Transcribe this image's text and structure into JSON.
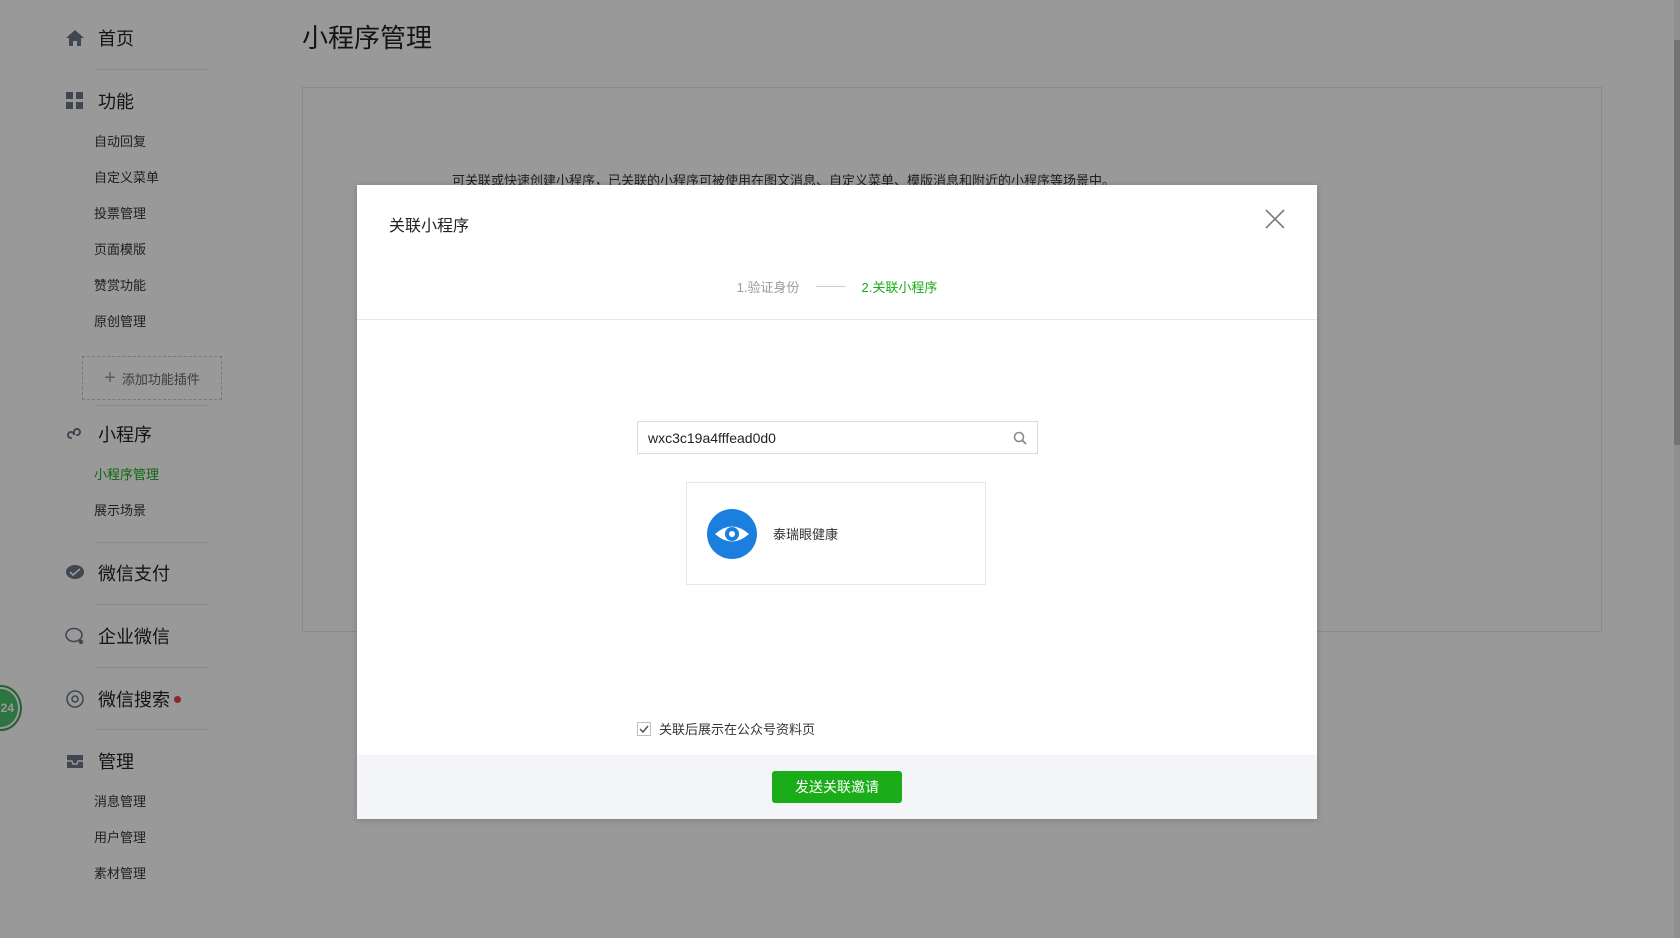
{
  "sidebar": {
    "home": "首页",
    "features": {
      "label": "功能",
      "items": [
        "自动回复",
        "自定义菜单",
        "投票管理",
        "页面模版",
        "赞赏功能",
        "原创管理"
      ]
    },
    "add_plugin": "添加功能插件",
    "miniprogram": {
      "label": "小程序",
      "items": [
        "小程序管理",
        "展示场景"
      ]
    },
    "wechat_pay": "微信支付",
    "wecom": "企业微信",
    "wechat_search": "微信搜索",
    "manage": {
      "label": "管理",
      "items": [
        "消息管理",
        "用户管理",
        "素材管理"
      ]
    },
    "float_badge": "24"
  },
  "main": {
    "title": "小程序管理",
    "intro": "可关联或快速创建小程序，已关联的小程序可被使用在图文消息、自定义菜单、模版消息和附近的小程序等场景中。"
  },
  "dialog": {
    "title": "关联小程序",
    "steps": [
      "1.验证身份",
      "2.关联小程序"
    ],
    "search_value": "wxc3c19a4fffead0d0",
    "result_name": "泰瑞眼健康",
    "checkbox_label": "关联后展示在公众号资料页",
    "checkbox_checked": true,
    "submit_label": "发送关联邀请"
  },
  "colors": {
    "brand_green": "#1aad19",
    "logo_blue": "#1b7fe0",
    "badge_red": "#e64340"
  }
}
